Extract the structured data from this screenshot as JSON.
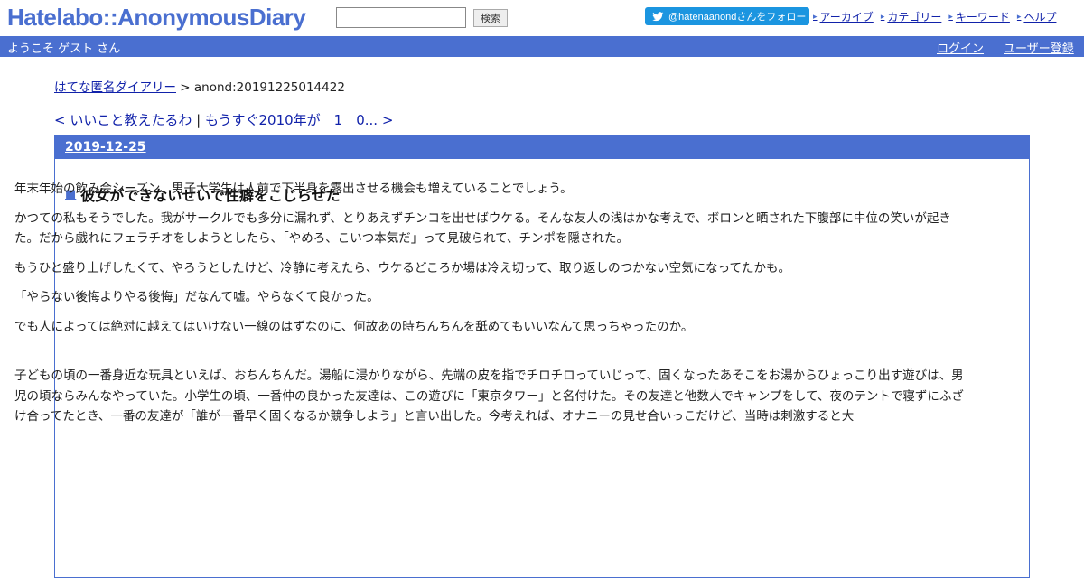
{
  "header": {
    "logo": "Hatelabo::AnonymousDiary",
    "search_placeholder": "",
    "search_button": "検索",
    "twitter_button": "@hatenaanondさんをフォロー",
    "links": [
      "アーカイブ",
      "カテゴリー",
      "キーワード",
      "ヘルプ"
    ],
    "welcome": "ようこそ ゲスト さん",
    "login": "ログイン",
    "register": "ユーザー登録"
  },
  "breadcrumb": {
    "home": "はてな匿名ダイアリー",
    "sep": " > ",
    "current": "anond:20191225014422"
  },
  "pager": {
    "prev": "< いいこと教えたるわ",
    "sep": " | ",
    "next": "もうすぐ2010年が　1　0... >"
  },
  "entry": {
    "date": "2019-12-25",
    "square": "■",
    "title": "彼女ができないせいで性癖をこじらせた",
    "paragraphs": [
      "年末年始の飲み会シーズン、男子大学生は人前で下半身を露出させる機会も増えていることでしょう。",
      "かつての私もそうでした。我がサークルでも多分に漏れず、とりあえずチンコを出せばウケる。そんな友人の浅はかな考えで、ボロンと晒された下腹部に中位の笑いが起きた。だから戯れにフェラチオをしようとしたら、「やめろ、こいつ本気だ」って見破られて、チンポを隠された。",
      "もうひと盛り上げしたくて、やろうとしたけど、冷静に考えたら、ウケるどころか場は冷え切って、取り返しのつかない空気になってたかも。",
      "「やらない後悔よりやる後悔」だなんて嘘。やらなくて良かった。",
      "でも人によっては絶対に越えてはいけない一線のはずなのに、何故あの時ちんちんを舐めてもいいなんて思っちゃったのか。",
      "子どもの頃の一番身近な玩具といえば、おちんちんだ。湯船に浸かりながら、先端の皮を指でチロチロっていじって、固くなったあそこをお湯からひょっこり出す遊びは、男児の頃ならみんなやっていた。小学生の頃、一番仲の良かった友達は、この遊びに「東京タワー」と名付けた。その友達と他数人でキャンプをして、夜のテントで寝ずにふざけ合ってたとき、一番の友達が「誰が一番早く固くなるか競争しよう」と言い出した。今考えれば、オナニーの見せ合いっこだけど、当時は刺激すると大"
    ]
  }
}
